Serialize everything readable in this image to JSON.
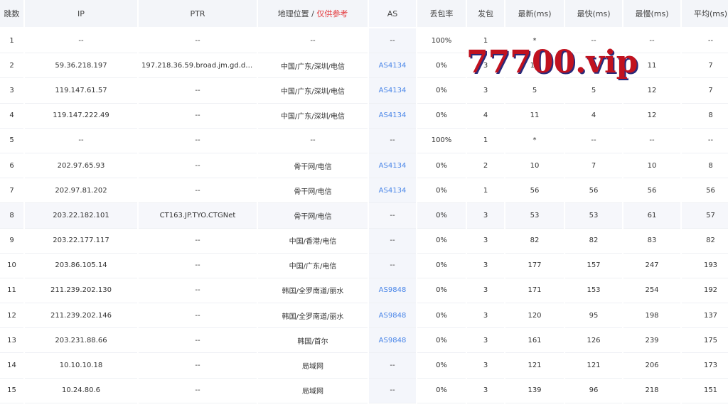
{
  "headers": {
    "hop": "跳数",
    "ip": "IP",
    "ptr": "PTR",
    "geo": "地理位置 / ",
    "geo_ref": "仅供参考",
    "as": "AS",
    "loss": "丢包率",
    "sent": "发包",
    "last": "最新(ms)",
    "best": "最快(ms)",
    "worst": "最慢(ms)",
    "avg": "平均(ms)"
  },
  "rows": [
    {
      "hop": "1",
      "ip": "--",
      "ptr": "--",
      "geo": "--",
      "as": "--",
      "loss": "100%",
      "sent": "1",
      "last": "*",
      "best": "--",
      "worst": "--",
      "avg": "--"
    },
    {
      "hop": "2",
      "ip": "59.36.218.197",
      "ptr": "197.218.36.59.broad.jm.gd.dy...",
      "geo": "中国/广东/深圳/电信",
      "as": "AS4134",
      "loss": "0%",
      "sent": "3",
      "last": "11",
      "best": "5",
      "worst": "11",
      "avg": "7"
    },
    {
      "hop": "3",
      "ip": "119.147.61.57",
      "ptr": "--",
      "geo": "中国/广东/深圳/电信",
      "as": "AS4134",
      "loss": "0%",
      "sent": "3",
      "last": "5",
      "best": "5",
      "worst": "12",
      "avg": "7"
    },
    {
      "hop": "4",
      "ip": "119.147.222.49",
      "ptr": "--",
      "geo": "中国/广东/深圳/电信",
      "as": "AS4134",
      "loss": "0%",
      "sent": "4",
      "last": "11",
      "best": "4",
      "worst": "12",
      "avg": "8"
    },
    {
      "hop": "5",
      "ip": "--",
      "ptr": "--",
      "geo": "--",
      "as": "--",
      "loss": "100%",
      "sent": "1",
      "last": "*",
      "best": "--",
      "worst": "--",
      "avg": "--"
    },
    {
      "hop": "6",
      "ip": "202.97.65.93",
      "ptr": "--",
      "geo": "骨干网/电信",
      "as": "AS4134",
      "loss": "0%",
      "sent": "2",
      "last": "10",
      "best": "7",
      "worst": "10",
      "avg": "8"
    },
    {
      "hop": "7",
      "ip": "202.97.81.202",
      "ptr": "--",
      "geo": "骨干网/电信",
      "as": "AS4134",
      "loss": "0%",
      "sent": "1",
      "last": "56",
      "best": "56",
      "worst": "56",
      "avg": "56"
    },
    {
      "hop": "8",
      "ip": "203.22.182.101",
      "ptr": "CT163.JP.TYO.CTGNet",
      "geo": "骨干网/电信",
      "as": "--",
      "loss": "0%",
      "sent": "3",
      "last": "53",
      "best": "53",
      "worst": "61",
      "avg": "57"
    },
    {
      "hop": "9",
      "ip": "203.22.177.117",
      "ptr": "--",
      "geo": "中国/香港/电信",
      "as": "--",
      "loss": "0%",
      "sent": "3",
      "last": "82",
      "best": "82",
      "worst": "83",
      "avg": "82"
    },
    {
      "hop": "10",
      "ip": "203.86.105.14",
      "ptr": "--",
      "geo": "中国/广东/电信",
      "as": "--",
      "loss": "0%",
      "sent": "3",
      "last": "177",
      "best": "157",
      "worst": "247",
      "avg": "193"
    },
    {
      "hop": "11",
      "ip": "211.239.202.130",
      "ptr": "--",
      "geo": "韩国/全罗南道/丽水",
      "as": "AS9848",
      "loss": "0%",
      "sent": "3",
      "last": "171",
      "best": "153",
      "worst": "254",
      "avg": "192"
    },
    {
      "hop": "12",
      "ip": "211.239.202.146",
      "ptr": "--",
      "geo": "韩国/全罗南道/丽水",
      "as": "AS9848",
      "loss": "0%",
      "sent": "3",
      "last": "120",
      "best": "95",
      "worst": "198",
      "avg": "137"
    },
    {
      "hop": "13",
      "ip": "203.231.88.66",
      "ptr": "--",
      "geo": "韩国/首尔",
      "as": "AS9848",
      "loss": "0%",
      "sent": "3",
      "last": "161",
      "best": "126",
      "worst": "239",
      "avg": "175"
    },
    {
      "hop": "14",
      "ip": "10.10.10.18",
      "ptr": "--",
      "geo": "局域网",
      "as": "--",
      "loss": "0%",
      "sent": "3",
      "last": "121",
      "best": "121",
      "worst": "206",
      "avg": "173"
    },
    {
      "hop": "15",
      "ip": "10.24.80.6",
      "ptr": "--",
      "geo": "局域网",
      "as": "--",
      "loss": "0%",
      "sent": "3",
      "last": "139",
      "best": "96",
      "worst": "218",
      "avg": "151"
    }
  ],
  "highlight_row": "8",
  "watermark": "77700.vip",
  "colors": {
    "header_bg": "#f3f5f9",
    "as_link": "#4a86e8",
    "reference_red": "#e4393c",
    "watermark_red": "#c1121f",
    "watermark_shadow": "#2a2a7a"
  }
}
